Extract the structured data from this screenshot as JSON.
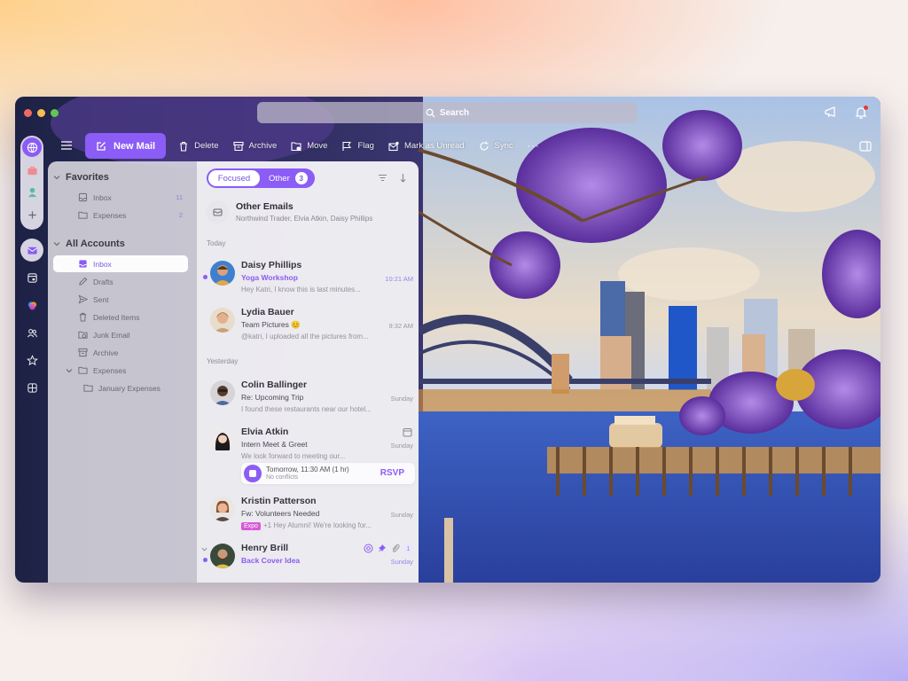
{
  "window": {
    "search_placeholder": "Search"
  },
  "toolbar": {
    "new_mail": "New Mail",
    "actions": [
      {
        "label": "Delete",
        "icon": "trash-icon"
      },
      {
        "label": "Archive",
        "icon": "archive-icon"
      },
      {
        "label": "Move",
        "icon": "move-folder-icon"
      },
      {
        "label": "Flag",
        "icon": "flag-icon"
      },
      {
        "label": "Mark as Unread",
        "icon": "mark-unread-icon"
      },
      {
        "label": "Sync",
        "icon": "sync-icon"
      }
    ],
    "more": "···"
  },
  "rail": {
    "items": [
      "globe-icon",
      "briefcase-icon",
      "person-icon",
      "add-icon",
      "mail-icon",
      "calendar-icon",
      "copilot-icon",
      "people-icon",
      "favorites-icon",
      "apps-icon"
    ]
  },
  "folders": {
    "favorites_label": "Favorites",
    "favorites": [
      {
        "label": "Inbox",
        "count": "11"
      },
      {
        "label": "Expenses",
        "count": "2"
      }
    ],
    "accounts_label": "All Accounts",
    "accounts": [
      {
        "label": "Inbox",
        "active": true
      },
      {
        "label": "Drafts"
      },
      {
        "label": "Sent"
      },
      {
        "label": "Deleted Items"
      },
      {
        "label": "Junk Email"
      },
      {
        "label": "Archive"
      },
      {
        "label": "Expenses"
      },
      {
        "label": "January Expenses"
      }
    ]
  },
  "list": {
    "tab_focused": "Focused",
    "tab_other": "Other",
    "other_count": "3",
    "other_emails": {
      "title": "Other Emails",
      "senders": "Northwind Trader, Elvia Atkin, Daisy Phillips"
    },
    "groups": {
      "today": "Today",
      "yesterday": "Yesterday"
    },
    "messages": [
      {
        "from": "Daisy Phillips",
        "subject": "Yoga Workshop",
        "preview": "Hey Katri, I know this is last minutes...",
        "time": "10:21 AM",
        "unread": true
      },
      {
        "from": "Lydia Bauer",
        "subject": "Team Pictures 😊",
        "preview": "@katri, I uploaded all the pictures from...",
        "time": "9:32 AM",
        "unread": false
      },
      {
        "from": "Colin Ballinger",
        "subject": "Re: Upcoming Trip",
        "preview": "I found these restaurants near our hotel...",
        "time": "Sunday",
        "unread": false
      },
      {
        "from": "Elvia Atkin",
        "subject": "Intern Meet & Greet",
        "preview": "We look forward to meeting our...",
        "time": "Sunday",
        "unread": false,
        "event": {
          "when": "Tomorrow, 11:30 AM (1 hr)",
          "status": "No conflicts",
          "action": "RSVP"
        }
      },
      {
        "from": "Kristin Patterson",
        "subject": "Fw: Volunteers Needed",
        "tag": "Expo",
        "preview": "+1 Hey Alumni! We're looking for...",
        "time": "Sunday",
        "unread": false
      },
      {
        "from": "Henry Brill",
        "subject": "Back Cover Idea",
        "preview": "",
        "time": "Sunday",
        "unread": true,
        "thread_count": "1"
      }
    ]
  },
  "colors": {
    "accent": "#8b5cf6",
    "tag_expo": "#d65ad6",
    "notification": "#e23b3b"
  }
}
